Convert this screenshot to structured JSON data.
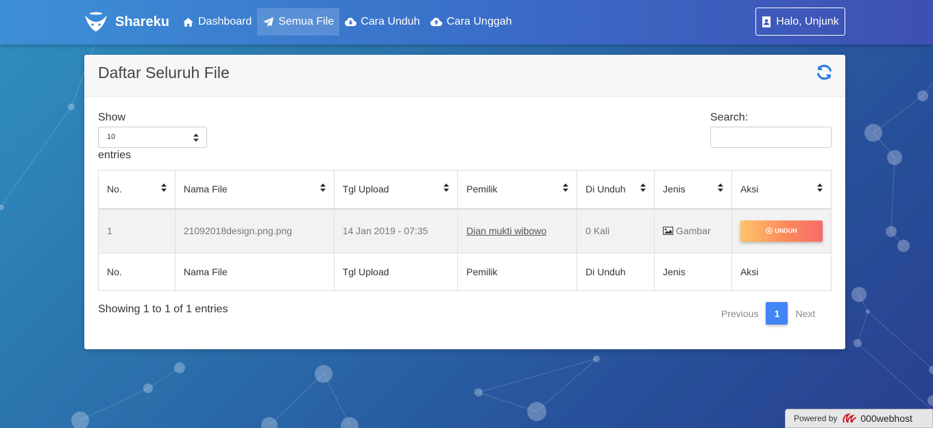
{
  "colors": {
    "accent": "#4285f4",
    "navbar": "#3a6fc9",
    "download_gradient_start": "#fdc46a",
    "download_gradient_end": "#f86b6b"
  },
  "navbar": {
    "brand": "Shareku",
    "items": [
      {
        "label": "Dashboard",
        "icon": "home-icon",
        "active": false
      },
      {
        "label": "Semua File",
        "icon": "paper-plane-icon",
        "active": true
      },
      {
        "label": "Cara Unduh",
        "icon": "cloud-download-icon",
        "active": false
      },
      {
        "label": "Cara Unggah",
        "icon": "cloud-upload-icon",
        "active": false
      }
    ],
    "user_label": "Halo, Unjunk"
  },
  "card": {
    "title": "Daftar Seluruh File"
  },
  "controls": {
    "show_label": "Show",
    "length_value": "10",
    "entries_label": "entries",
    "search_label": "Search:",
    "search_value": ""
  },
  "table": {
    "headers": [
      "No.",
      "Nama File",
      "Tgl Upload",
      "Pemilik",
      "Di Unduh",
      "Jenis",
      "Aksi"
    ],
    "rows": [
      {
        "no": "1",
        "file_name": "21092018design.png.png",
        "upload_date": "14 Jan 2019 - 07:35",
        "owner": "Dian mukti wibowo",
        "downloads": "0 Kali",
        "type": "Gambar",
        "action_label": "UNDUH"
      }
    ],
    "footers": [
      "No.",
      "Nama File",
      "Tgl Upload",
      "Pemilik",
      "Di Unduh",
      "Jenis",
      "Aksi"
    ]
  },
  "pagination": {
    "info": "Showing 1 to 1 of 1 entries",
    "previous": "Previous",
    "current": "1",
    "next": "Next"
  },
  "footer_badge": {
    "powered_by": "Powered by",
    "host": "000webhost"
  }
}
